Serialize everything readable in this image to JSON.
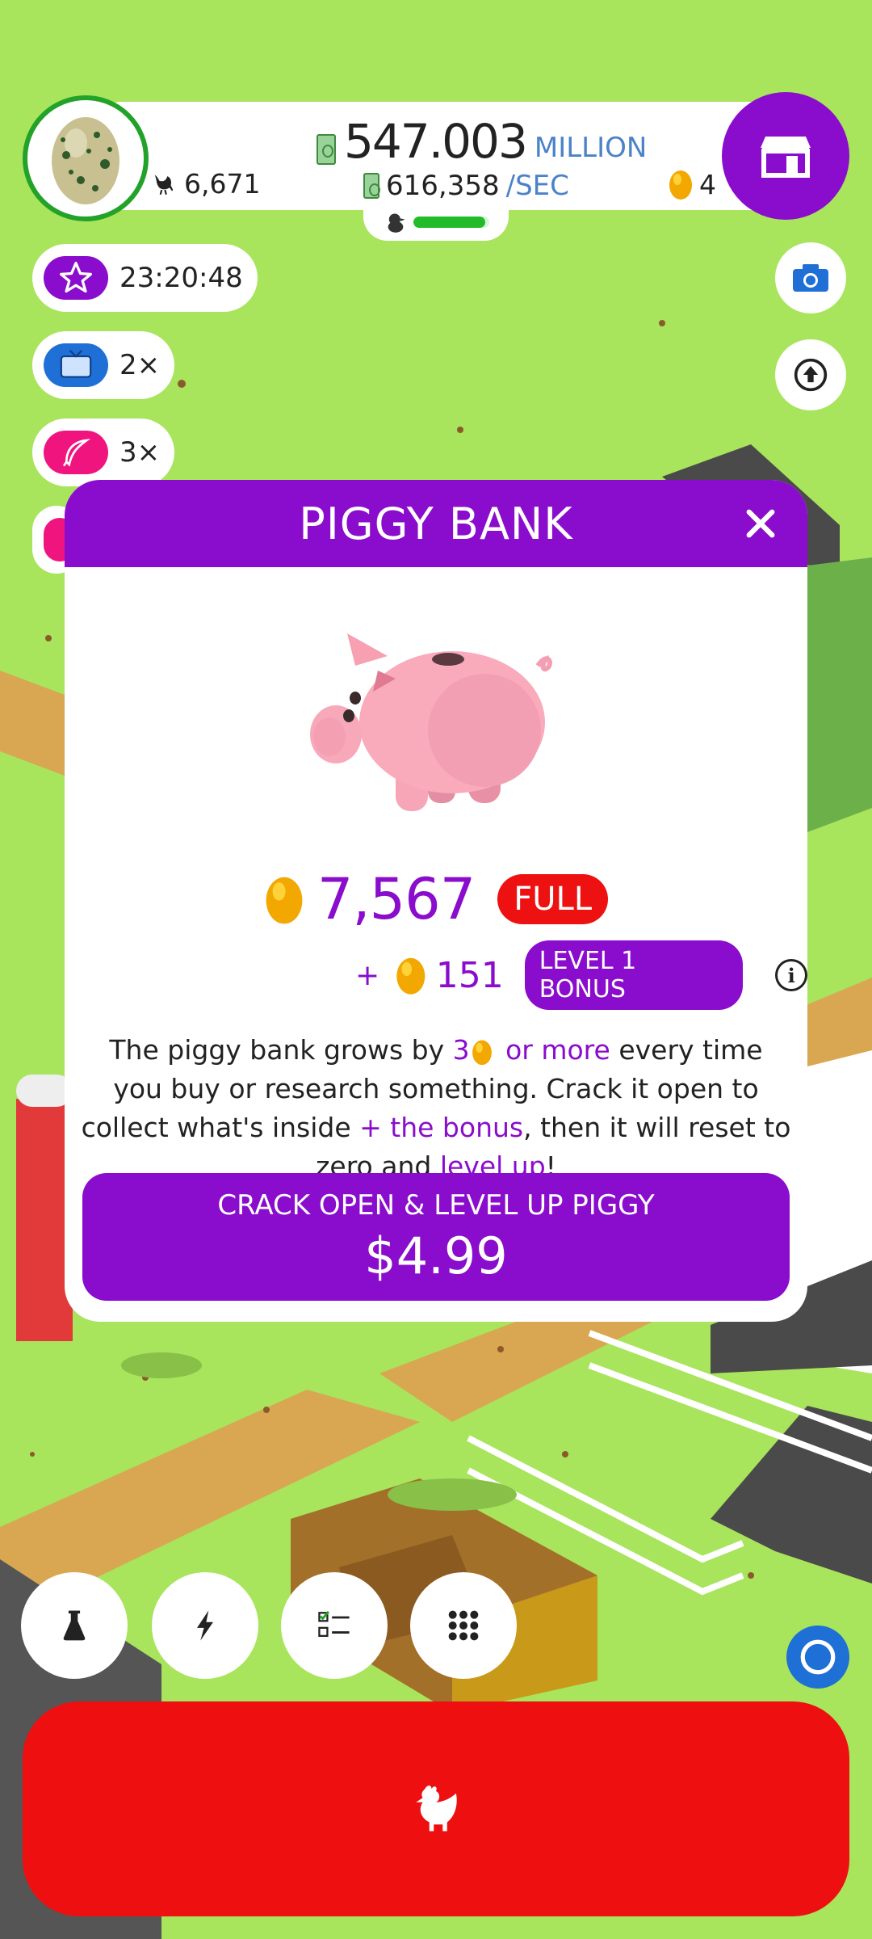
{
  "hud": {
    "money_value": "547.003",
    "money_unit": "MILLION",
    "rate_value": "616,358",
    "rate_unit": "/SEC",
    "chicken_count": "6,671",
    "golden_eggs": "4",
    "hatchery_progress": 0.95
  },
  "boosts": [
    {
      "icon": "star-icon",
      "label": "23:20:48",
      "color": "#8a0ccc"
    },
    {
      "icon": "tv-icon",
      "label": "2×",
      "color": "#1e6fd6"
    },
    {
      "icon": "feather-icon",
      "label": "3×",
      "color": "#f0147f"
    }
  ],
  "modal": {
    "title": "PIGGY BANK",
    "amount": "7,567",
    "status": "FULL",
    "bonus_prefix": "+",
    "bonus_amount": "151",
    "bonus_label": "LEVEL 1 BONUS",
    "desc_1": "The piggy bank grows by ",
    "desc_num": "3",
    "desc_more": "or more",
    "desc_2": " every time you buy or research something. Crack it open to collect what's inside ",
    "desc_bonus": "+ the bonus",
    "desc_3": ", then it will reset to zero and ",
    "desc_lvl": "level up",
    "desc_4": "!",
    "button_label": "CRACK OPEN & LEVEL UP PIGGY",
    "button_price": "$4.99"
  },
  "colors": {
    "brand_purple": "#8a0ccc",
    "hatch_red": "#ee0f10",
    "grass": "#a8e45c",
    "money_blue": "#4b82c8"
  }
}
